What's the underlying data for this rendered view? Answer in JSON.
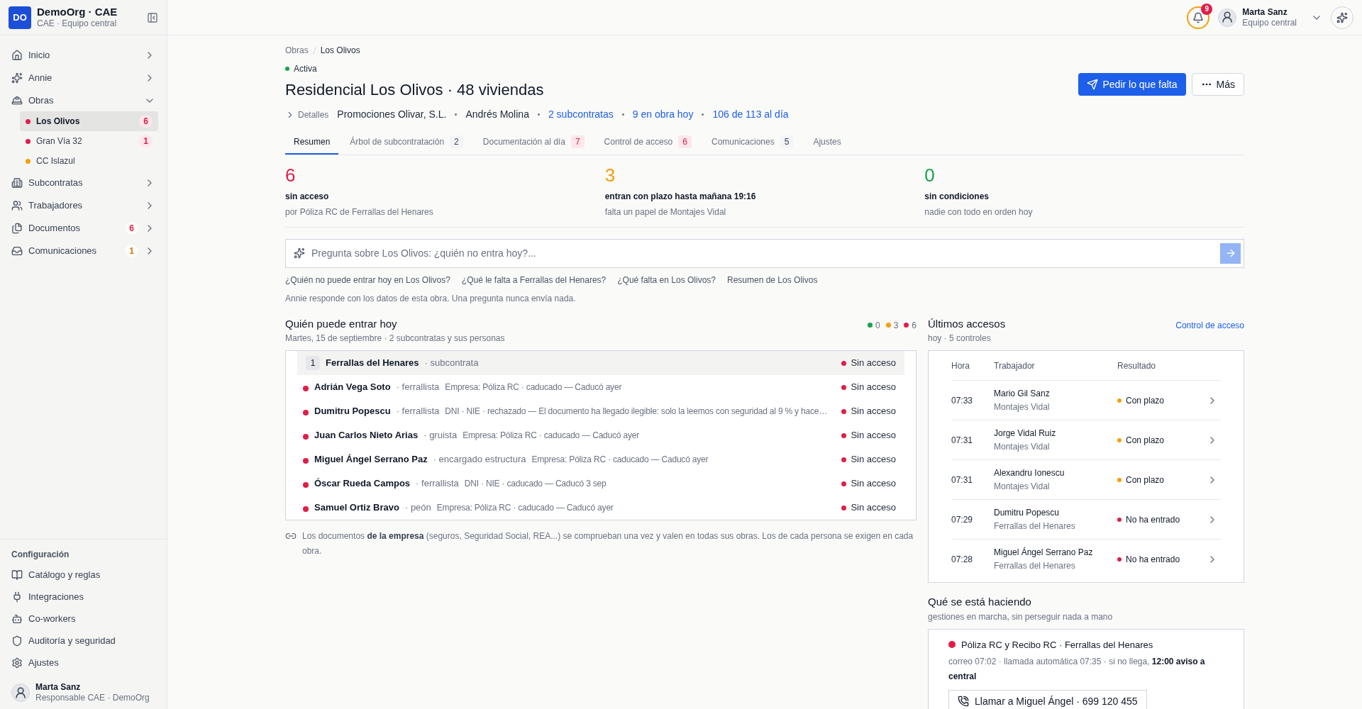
{
  "org": {
    "badge": "DO",
    "name": "DemoOrg · CAE",
    "subtitle": "CAE · Equipo central"
  },
  "sidebar": {
    "items": [
      {
        "label": "Inicio",
        "expanded": false
      },
      {
        "label": "Annie",
        "expanded": false
      },
      {
        "label": "Obras",
        "expanded": true,
        "children": [
          {
            "label": "Los Olivos",
            "color": "#e11d48",
            "count": "6",
            "selected": true
          },
          {
            "label": "Gran Vía 32",
            "color": "#e11d48",
            "count": "1",
            "selected": false
          },
          {
            "label": "CC Islazul",
            "color": "#f59e0b",
            "selected": false
          }
        ]
      },
      {
        "label": "Subcontratas",
        "expanded": false
      },
      {
        "label": "Trabajadores",
        "expanded": false
      },
      {
        "label": "Documentos",
        "expanded": false,
        "badge": {
          "text": "6",
          "color": "#e11d48"
        }
      },
      {
        "label": "Comunicaciones",
        "expanded": false,
        "badge": {
          "text": "1",
          "color": "#d97706"
        }
      }
    ],
    "config_heading": "Configuración",
    "config_items": [
      "Catálogo y reglas",
      "Integraciones",
      "Co-workers",
      "Auditoría y seguridad",
      "Ajustes"
    ],
    "user": {
      "name": "Marta Sanz",
      "role": "Responsable CAE · DemoOrg"
    }
  },
  "topbar": {
    "notifications": "9",
    "user": {
      "name": "Marta Sanz",
      "role": "Equipo central"
    }
  },
  "breadcrumb": [
    "Obras",
    "Los Olivos"
  ],
  "status": {
    "label": "Activa",
    "color": "#16a34a"
  },
  "title": "Residencial Los Olivos · 48 viviendas",
  "actions": [
    {
      "label": "Pedir lo que falta",
      "kind": "primary"
    },
    {
      "label": "Más",
      "kind": "secondary"
    }
  ],
  "details": {
    "label": "Detalles",
    "expanded": false,
    "facts": [
      {
        "text": "Promociones Olivar, S.L.",
        "link": false
      },
      {
        "text": "Andrés Molina",
        "link": false
      },
      {
        "text": "2 subcontratas",
        "link": true
      },
      {
        "text": "9 en obra hoy",
        "link": true
      },
      {
        "text": "106 de 113 al día",
        "link": true
      }
    ]
  },
  "tabs": [
    {
      "label": "Resumen",
      "selected": true
    },
    {
      "label": "Árbol de subcontratación",
      "count": "2",
      "alert": false,
      "selected": false
    },
    {
      "label": "Documentación al día",
      "count": "7",
      "alert": true,
      "selected": false
    },
    {
      "label": "Control de acceso",
      "count": "6",
      "alert": true,
      "selected": false
    },
    {
      "label": "Comunicaciones",
      "count": "5",
      "alert": false,
      "selected": false
    },
    {
      "label": "Ajustes",
      "selected": false
    }
  ],
  "stats": [
    {
      "value": "6",
      "label": "sin acceso",
      "detail": "por Póliza RC de Ferrallas del Henares",
      "color": "#e11d48"
    },
    {
      "value": "3",
      "label": "entran con plazo hasta mañana 19:16",
      "detail": "falta un papel de Montajes Vidal",
      "color": "#f59e0b"
    },
    {
      "value": "0",
      "label": "sin condiciones",
      "detail": "nadie con todo en orden hoy",
      "color": "#16a34a"
    }
  ],
  "ask": {
    "placeholder": "Pregunta sobre Los Olivos: ¿quién no entra hoy?...",
    "suggestions": [
      "¿Quién no puede entrar hoy en Los Olivos?",
      "¿Qué le falta a Ferrallas del Henares?",
      "¿Qué falta en Los Olivos?",
      "Resumen de Los Olivos"
    ],
    "note": "Annie responde con los datos de esta obra. Una pregunta nunca envía nada."
  },
  "entry": {
    "title": "Quién puede entrar hoy",
    "subtitle": "Martes, 15 de septiembre · 2 subcontratas y sus personas",
    "legend": [
      {
        "count": "0",
        "color": "#16a34a"
      },
      {
        "count": "3",
        "color": "#f59e0b"
      },
      {
        "count": "6",
        "color": "#e11d48"
      }
    ],
    "rows": [
      {
        "kind": "group",
        "number": "1",
        "name": "Ferrallas del Henares",
        "role": "· subcontrata",
        "status": "Sin acceso",
        "color": "#e11d48"
      },
      {
        "kind": "person",
        "name": "Adrián Vega Soto",
        "role": "· ferrallista",
        "detail": "Empresa: Póliza RC · caducado — Caducó ayer",
        "status": "Sin acceso",
        "color": "#e11d48"
      },
      {
        "kind": "person",
        "name": "Dumitru Popescu",
        "role": "· ferrallista",
        "detail": "DNI · NIE · rechazado — El documento ha llegado ilegible: solo la leemos con seguridad al 9 % y hace…",
        "status": "Sin acceso",
        "color": "#e11d48"
      },
      {
        "kind": "person",
        "name": "Juan Carlos Nieto Arias",
        "role": "· gruista",
        "detail": "Empresa: Póliza RC · caducado — Caducó ayer",
        "status": "Sin acceso",
        "color": "#e11d48"
      },
      {
        "kind": "person",
        "name": "Miguel Ángel Serrano Paz",
        "role": "· encargado estructura",
        "detail": "Empresa: Póliza RC · caducado — Caducó ayer",
        "status": "Sin acceso",
        "color": "#e11d48"
      },
      {
        "kind": "person",
        "name": "Óscar Rueda Campos",
        "role": "· ferrallista",
        "detail": "DNI · NIE · caducado — Caducó 3 sep",
        "status": "Sin acceso",
        "color": "#e11d48"
      },
      {
        "kind": "person",
        "name": "Samuel Ortiz Bravo",
        "role": "· peón",
        "detail": "Empresa: Póliza RC · caducado — Caducó ayer",
        "status": "Sin acceso",
        "color": "#e11d48"
      }
    ],
    "footnote": "Los documentos **de la empresa** (seguros, Seguridad Social, REA...) se comprueban una vez y valen en todas sus obras. Los de cada persona se exigen en cada obra."
  },
  "accesses": {
    "title": "Últimos accesos",
    "subtitle": "hoy · 5 controles",
    "link": "Control de acceso",
    "columns": [
      "Hora",
      "Trabajador",
      "Resultado"
    ],
    "rows": [
      {
        "time": "07:33",
        "worker": "Mario Gil Sanz",
        "company": "Montajes Vidal",
        "result": "Con plazo",
        "color": "#f59e0b"
      },
      {
        "time": "07:31",
        "worker": "Jorge Vidal Ruiz",
        "company": "Montajes Vidal",
        "result": "Con plazo",
        "color": "#f59e0b"
      },
      {
        "time": "07:31",
        "worker": "Alexandru Ionescu",
        "company": "Montajes Vidal",
        "result": "Con plazo",
        "color": "#f59e0b"
      },
      {
        "time": "07:29",
        "worker": "Dumitru Popescu",
        "company": "Ferrallas del Henares",
        "result": "No ha entrado",
        "color": "#e11d48"
      },
      {
        "time": "07:28",
        "worker": "Miguel Ángel Serrano Paz",
        "company": "Ferrallas del Henares",
        "result": "No ha entrado",
        "color": "#e11d48"
      }
    ]
  },
  "progress": {
    "title": "Qué se está haciendo",
    "subtitle": "gestiones en marcha, sin perseguir nada a mano",
    "cards": [
      {
        "title": "Póliza RC y Recibo RC · Ferrallas del Henares",
        "color": "#e11d48",
        "text": "correo 07:02 · llamada automática 07:35 · si no llega, **12:00 aviso a central**",
        "button": "Llamar a Miguel Ángel · 699 120 455"
      }
    ]
  }
}
